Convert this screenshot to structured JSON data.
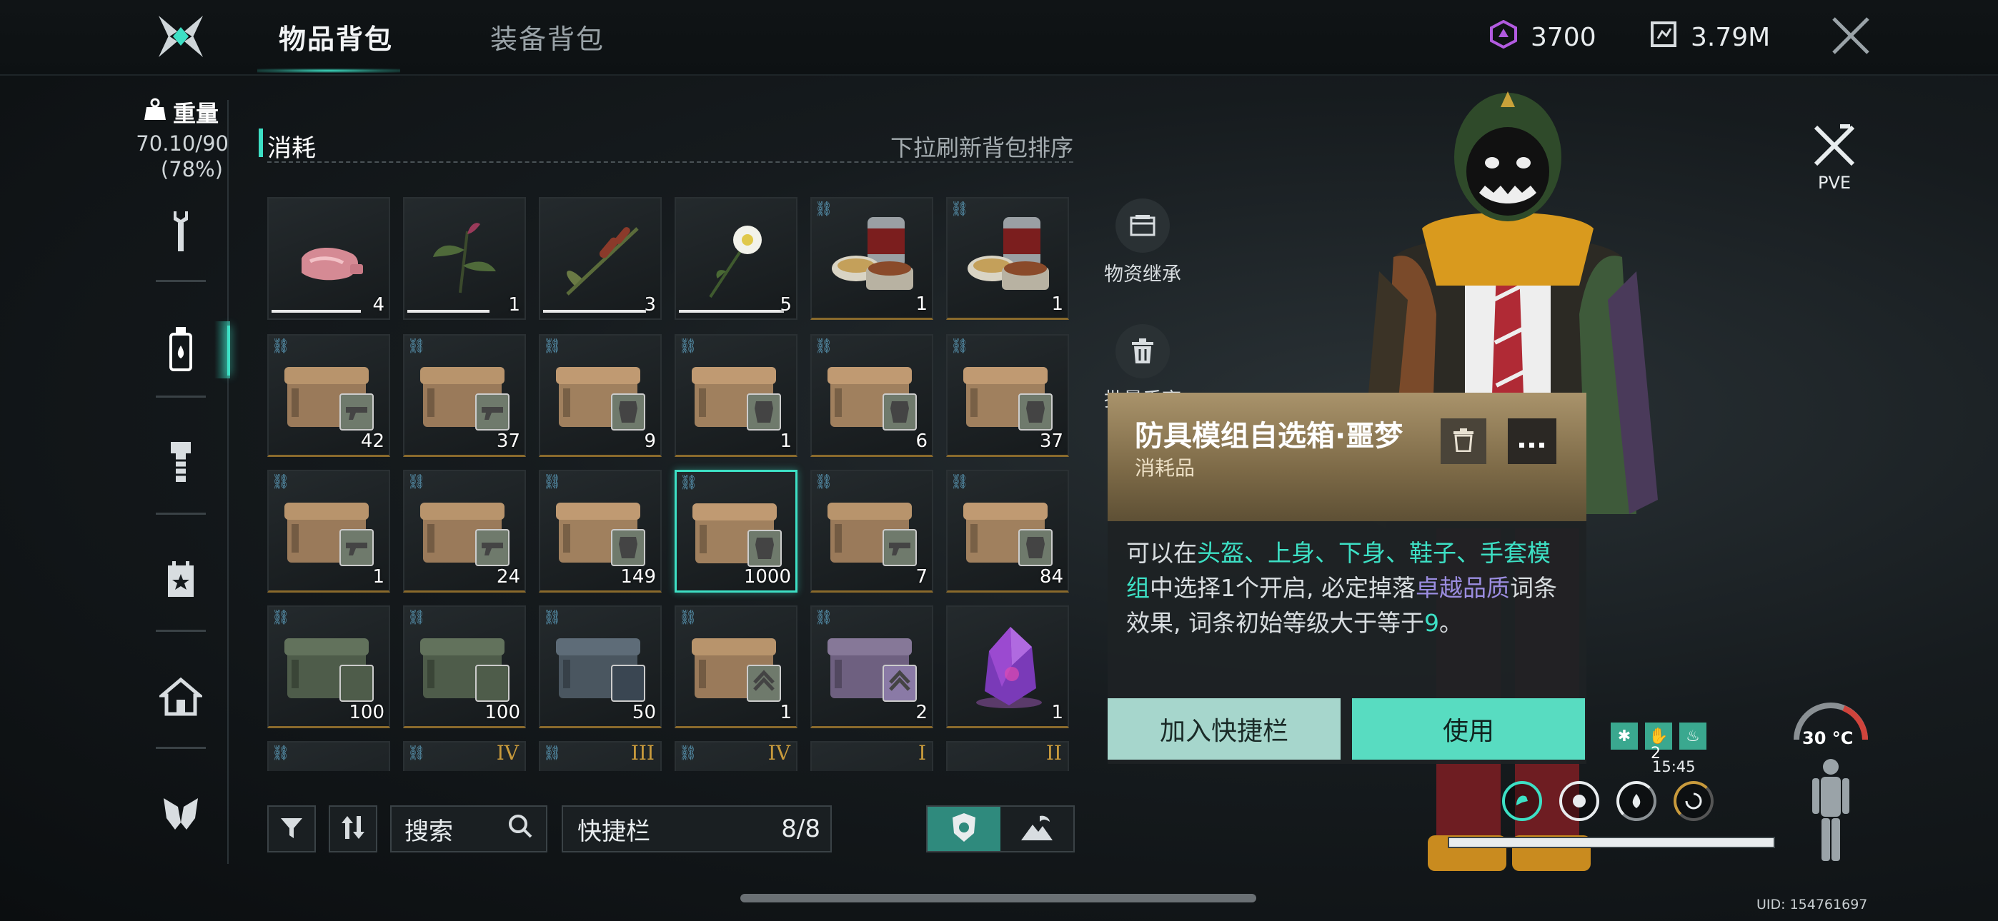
{
  "header": {
    "tabs": [
      {
        "label": "物品背包",
        "active": true
      },
      {
        "label": "装备背包",
        "active": false
      }
    ],
    "currencies": [
      {
        "icon": "crystal-icon",
        "value": "3700",
        "color": "#b25be0"
      },
      {
        "icon": "chip-icon",
        "value": "3.79M",
        "color": "#d8dde0"
      }
    ]
  },
  "sidebar": {
    "weight_title": "重量",
    "weight_value": "70.10/90",
    "weight_percent": "(78%)",
    "items": [
      {
        "icon": "wrench-icon",
        "active": false
      },
      {
        "icon": "bottle-icon",
        "active": true
      },
      {
        "icon": "bolt-icon",
        "active": false
      },
      {
        "icon": "calendar-star-icon",
        "active": false
      },
      {
        "icon": "house-icon",
        "active": false
      },
      {
        "icon": "emblem-icon",
        "active": false
      }
    ]
  },
  "inventory": {
    "category": "消耗",
    "sort_hint": "下拉刷新背包排序",
    "items": [
      {
        "art": "meat",
        "count": "4",
        "durability": 0.78
      },
      {
        "art": "herb",
        "count": "1",
        "durability": 0.72
      },
      {
        "art": "cattail",
        "count": "3",
        "durability": 0.9
      },
      {
        "art": "flower",
        "count": "5",
        "durability": 0.92
      },
      {
        "art": "canned-food",
        "count": "1",
        "linked": true
      },
      {
        "art": "canned-food",
        "count": "1",
        "linked": true
      },
      {
        "art": "crate-gun",
        "count": "42",
        "linked": true
      },
      {
        "art": "crate-gun",
        "count": "37",
        "linked": true
      },
      {
        "art": "crate-armor",
        "count": "9",
        "linked": true
      },
      {
        "art": "crate-armor",
        "count": "1",
        "linked": true
      },
      {
        "art": "crate-armor",
        "count": "6",
        "linked": true
      },
      {
        "art": "crate-armor",
        "count": "37",
        "linked": true
      },
      {
        "art": "crate-gun",
        "count": "1",
        "linked": true
      },
      {
        "art": "crate-gun",
        "count": "24",
        "linked": true
      },
      {
        "art": "crate-armor",
        "count": "149",
        "linked": true
      },
      {
        "art": "crate-armor",
        "count": "1000",
        "linked": true,
        "selected": true
      },
      {
        "art": "crate-gun",
        "count": "7",
        "linked": true
      },
      {
        "art": "crate-armor",
        "count": "84",
        "linked": true
      },
      {
        "art": "crate-green",
        "count": "100",
        "linked": true
      },
      {
        "art": "crate-green",
        "count": "100",
        "linked": true
      },
      {
        "art": "crate-blue",
        "count": "50",
        "linked": true
      },
      {
        "art": "crate-rank",
        "count": "1",
        "linked": true
      },
      {
        "art": "crate-purple",
        "count": "2",
        "linked": true
      },
      {
        "art": "crystal",
        "count": "1",
        "linked": false
      },
      {
        "art": "partial",
        "count": "",
        "linked": true,
        "tier": ""
      },
      {
        "art": "partial",
        "count": "",
        "linked": true,
        "tier": "IV"
      },
      {
        "art": "partial",
        "count": "",
        "linked": true,
        "tier": "III"
      },
      {
        "art": "partial",
        "count": "",
        "linked": true,
        "tier": "IV"
      },
      {
        "art": "partial",
        "count": "",
        "linked": false,
        "tier": "I"
      },
      {
        "art": "partial",
        "count": "",
        "linked": false,
        "tier": "II"
      }
    ]
  },
  "toolbar": {
    "search_placeholder": "搜索",
    "quickbar_label": "快捷栏",
    "quickbar_count": "8/8"
  },
  "side_actions": {
    "inherit_label": "物资继承",
    "discard_label": "批量丢弃"
  },
  "popup": {
    "title": "防具模组自选箱·噩梦",
    "type": "消耗品",
    "desc_1": "可以在",
    "desc_parts": "头盔、上身、下身、鞋子、手套模组",
    "desc_2": "中选择1个开启, 必定掉落",
    "desc_quality": "卓越品质",
    "desc_3": "词条效果, 词条初始等级大于等于",
    "desc_level": "9",
    "desc_end": "。",
    "add_quickbar_label": "加入快捷栏",
    "use_label": "使用"
  },
  "character": {
    "mode_label": "PVE",
    "buff_count": "2",
    "time": "15:45",
    "temperature": "30 °C",
    "uid": "UID: 154761697"
  },
  "colors": {
    "accent": "#3de0c5",
    "tier_gold": "#c89a3c",
    "rare_purple": "#9b8de0"
  }
}
